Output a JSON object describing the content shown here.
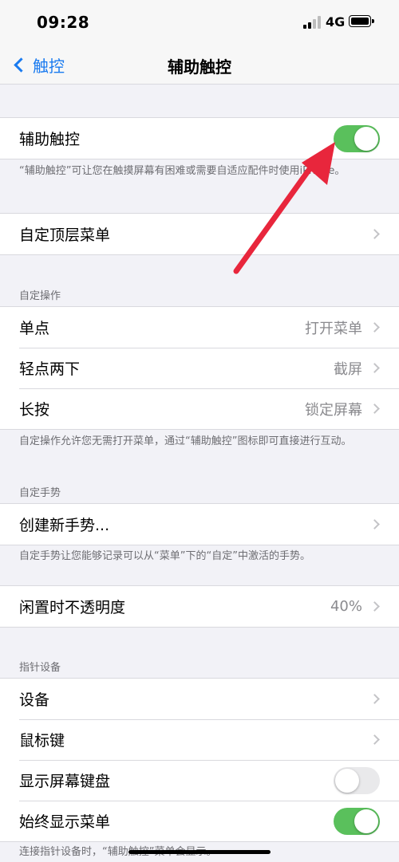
{
  "status": {
    "time": "09:28",
    "network": "4G"
  },
  "nav": {
    "back_label": "触控",
    "title": "辅助触控"
  },
  "main_toggle": {
    "label": "辅助触控",
    "on": true
  },
  "main_note": "“辅助触控”可让您在触摸屏幕有困难或需要自适应配件时使用iPhone。",
  "top_menu": {
    "label": "自定顶层菜单"
  },
  "custom_actions": {
    "header": "自定操作",
    "rows": [
      {
        "label": "单点",
        "value": "打开菜单"
      },
      {
        "label": "轻点两下",
        "value": "截屏"
      },
      {
        "label": "长按",
        "value": "锁定屏幕"
      }
    ],
    "note": "自定操作允许您无需打开菜单，通过“辅助触控”图标即可直接进行互动。"
  },
  "custom_gestures": {
    "header": "自定手势",
    "create_label": "创建新手势...",
    "note": "自定手势让您能够记录可以从“菜单”下的“自定”中激活的手势。"
  },
  "idle_opacity": {
    "label": "闲置时不透明度",
    "value": "40%"
  },
  "pointer": {
    "header": "指针设备",
    "rows": [
      {
        "label": "设备"
      },
      {
        "label": "鼠标键"
      },
      {
        "label": "显示屏幕键盘",
        "toggle": false
      },
      {
        "label": "始终显示菜单",
        "toggle": true
      }
    ],
    "note": "连接指针设备时，“辅助触控”菜单会显示。"
  },
  "colors": {
    "accent": "#1a7bf0",
    "toggle_on": "#5ac05c",
    "annotation": "#e8263c"
  }
}
